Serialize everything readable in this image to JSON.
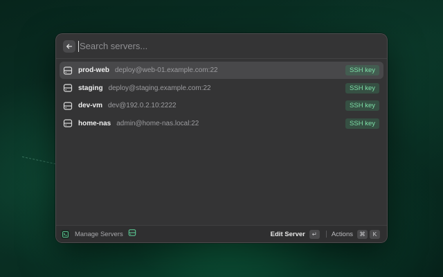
{
  "search": {
    "placeholder": "Search servers...",
    "value": ""
  },
  "servers": [
    {
      "name": "prod-web",
      "address": "deploy@web-01.example.com:22",
      "auth": "SSH key",
      "selected": true
    },
    {
      "name": "staging",
      "address": "deploy@staging.example.com:22",
      "auth": "SSH key",
      "selected": false
    },
    {
      "name": "dev-vm",
      "address": "dev@192.0.2.10:2222",
      "auth": "SSH key",
      "selected": false
    },
    {
      "name": "home-nas",
      "address": "admin@home-nas.local:22",
      "auth": "SSH key",
      "selected": false
    }
  ],
  "footer": {
    "title": "Manage Servers",
    "primary_action": "Edit Server",
    "primary_key": "↵",
    "actions_label": "Actions",
    "actions_keys": [
      "⌘",
      "K"
    ]
  },
  "colors": {
    "badge_text": "#7ee0a8",
    "badge_bg": "#2f5a42",
    "accent_green": "#5ed39a",
    "window_bg": "#343435",
    "selected_row": "#48484a"
  },
  "icons": {
    "back": "arrow-left-icon",
    "server": "server-icon",
    "app": "terminal-app-icon"
  }
}
